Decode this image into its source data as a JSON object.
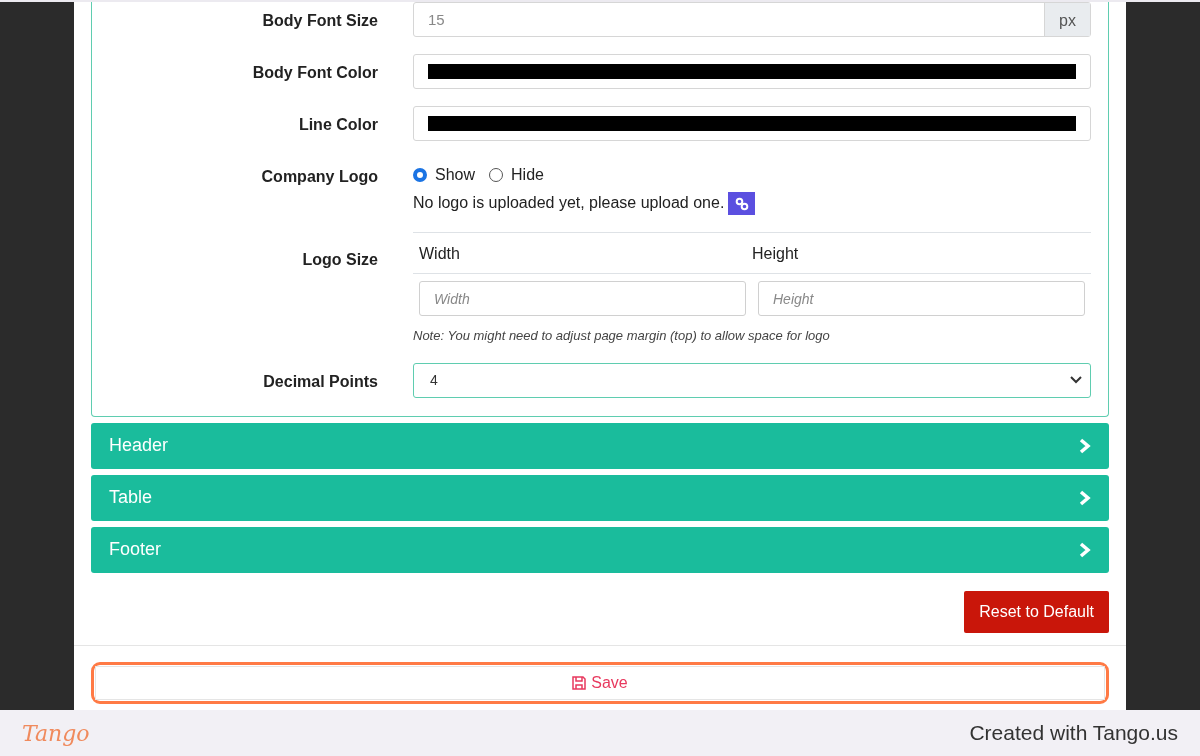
{
  "settings": [
    {
      "kind": "number",
      "label": "Body Font Size",
      "value": "15",
      "addon": "px"
    },
    {
      "kind": "color",
      "label": "Body Font Color",
      "color": "#000000"
    },
    {
      "kind": "color",
      "label": "Line Color",
      "color": "#000000"
    },
    {
      "kind": "radio",
      "label": "Company Logo",
      "options": [
        {
          "label": "Show",
          "selected": true
        },
        {
          "label": "Hide",
          "selected": false
        }
      ],
      "note": "No logo is uploaded yet, please upload one."
    },
    {
      "kind": "size",
      "label": "Logo Size",
      "columns": [
        "Width",
        "Height"
      ],
      "fields": [
        {
          "placeholder": "Width"
        },
        {
          "placeholder": "Height"
        }
      ],
      "note": "Note: You might need to adjust page margin (top) to allow space for logo"
    },
    {
      "kind": "select",
      "label": "Decimal Points",
      "value": "4"
    }
  ],
  "sections": [
    {
      "title": "Header",
      "expanded": false
    },
    {
      "title": "Table",
      "expanded": false
    },
    {
      "title": "Footer",
      "expanded": false
    }
  ],
  "reset_button": "Reset to Default",
  "save_button": "Save",
  "footer": {
    "logo": "Tango",
    "credit": "Created with Tango.us"
  }
}
